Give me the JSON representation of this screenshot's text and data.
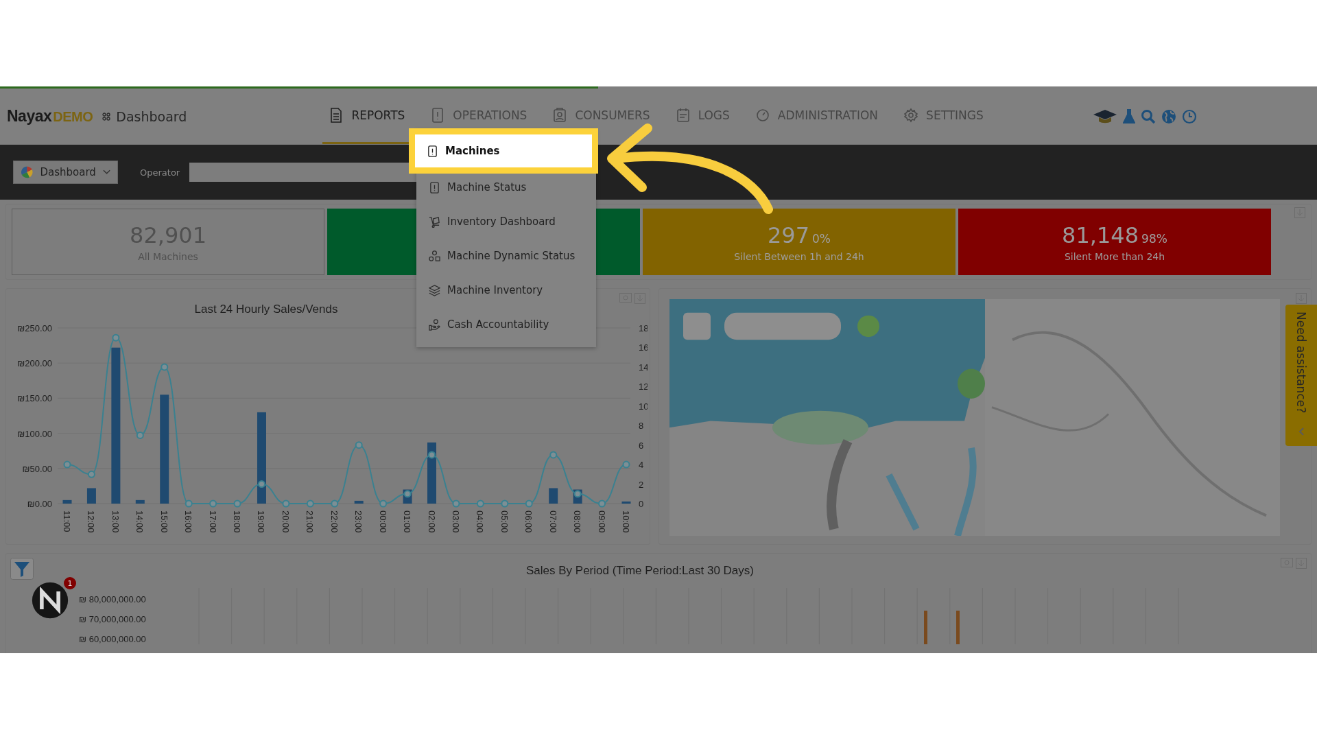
{
  "progress": {
    "level": 0.454
  },
  "header": {
    "logo": {
      "brand": "Nayax",
      "suffix": "DEMO"
    },
    "page_title": "Dashboard",
    "nav": [
      {
        "label": "REPORTS",
        "selected": true
      },
      {
        "label": "OPERATIONS",
        "selected": false
      },
      {
        "label": "CONSUMERS",
        "selected": false
      },
      {
        "label": "LOGS",
        "selected": false
      },
      {
        "label": "ADMINISTRATION",
        "selected": false
      },
      {
        "label": "SETTINGS",
        "selected": false
      }
    ]
  },
  "toolbar": {
    "view_select": "Dashboard",
    "operator_label": "Operator"
  },
  "menu": {
    "items": [
      {
        "label": "Machines",
        "selected": true
      },
      {
        "label": "Machine Status",
        "selected": false
      },
      {
        "label": "Inventory Dashboard",
        "selected": false
      },
      {
        "label": "Machine Dynamic Status",
        "selected": false
      },
      {
        "label": "Machine Inventory",
        "selected": false
      },
      {
        "label": "Cash Accountability",
        "selected": false
      }
    ]
  },
  "stats": [
    {
      "kind": "outline",
      "value": "82,901",
      "label": "All Machines"
    },
    {
      "kind": "green"
    },
    {
      "kind": "amber",
      "value": "297",
      "percent": "0%",
      "label": "Silent Between 1h and 24h"
    },
    {
      "kind": "red",
      "value": "81,148",
      "percent": "98%",
      "label": "Silent More than 24h"
    }
  ],
  "hourly_chart": {
    "chart_data": {
      "type": "bar",
      "title": "Last 24 Hourly Sales/Vends",
      "categories": [
        "11:00",
        "12:00",
        "13:00",
        "14:00",
        "15:00",
        "16:00",
        "17:00",
        "18:00",
        "19:00",
        "20:00",
        "21:00",
        "22:00",
        "23:00",
        "00:00",
        "01:00",
        "02:00",
        "03:00",
        "04:00",
        "05:00",
        "06:00",
        "07:00",
        "08:00",
        "09:00",
        "10:00"
      ],
      "series": [
        {
          "color": "#1f4a70",
          "values": [
            5,
            22,
            222,
            5,
            155,
            0,
            0,
            0,
            130,
            0,
            0,
            0,
            4,
            0,
            20,
            87,
            0,
            0,
            0,
            0,
            22,
            20,
            0,
            3
          ]
        },
        {
          "type": "line",
          "axis": "y2",
          "marker": true,
          "color": "#3a8190",
          "values": [
            4,
            3,
            17,
            7,
            14,
            0,
            0,
            0,
            2,
            0,
            0,
            0,
            6,
            0,
            1,
            5,
            0,
            0,
            0,
            0,
            5,
            1,
            0,
            4
          ]
        }
      ],
      "grid": true,
      "ylim": [
        0,
        250
      ],
      "yticks": [
        {
          "value": 0,
          "label": "₪0.00"
        },
        {
          "value": 50,
          "label": "₪50.00"
        },
        {
          "value": 100,
          "label": "₪100.00"
        },
        {
          "value": 150,
          "label": "₪150.00"
        },
        {
          "value": 200,
          "label": "₪200.00"
        },
        {
          "value": 250,
          "label": "₪250.00"
        }
      ],
      "y2lim": [
        0,
        18
      ],
      "y2ticks": [
        0,
        2,
        4,
        6,
        8,
        10,
        12,
        14,
        16,
        18
      ]
    }
  },
  "period_chart": {
    "title": "Sales By Period (Time Period:Last 30 Days)",
    "y_labels": [
      "₪ 80,000,000.00",
      "₪ 70,000,000.00",
      "₪ 60,000,000.00"
    ]
  },
  "notification_badge": "1",
  "assistance": {
    "label": "Need assistance?"
  }
}
